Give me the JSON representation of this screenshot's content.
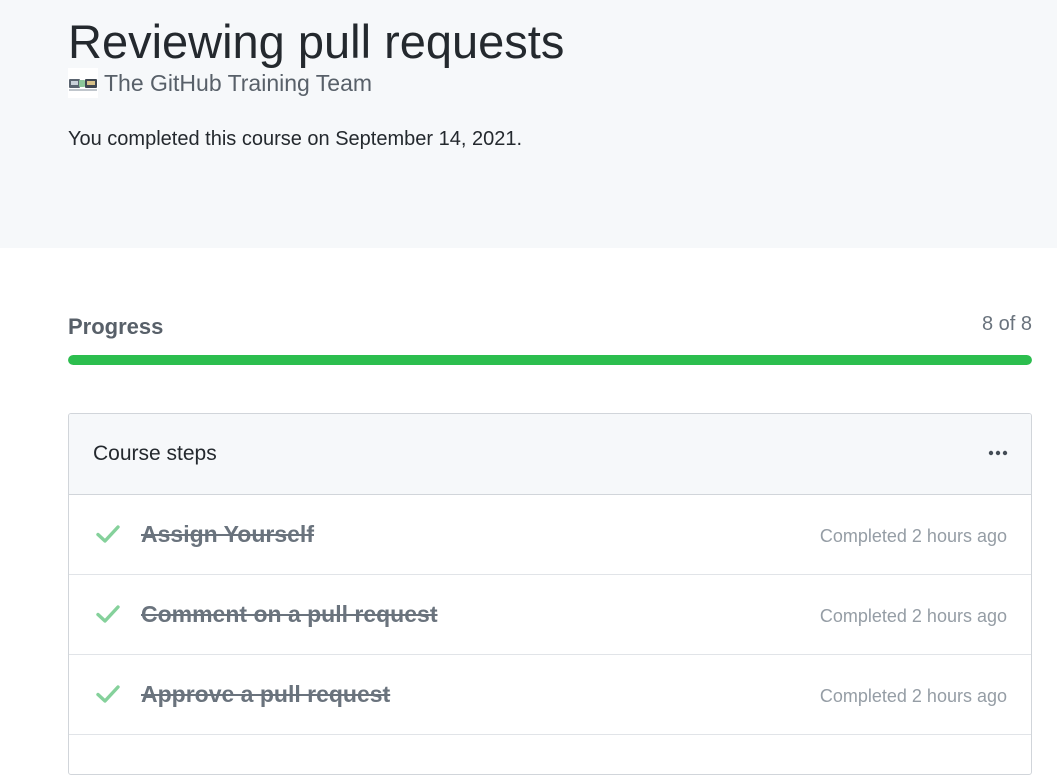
{
  "course": {
    "title": "Reviewing pull requests",
    "author": "The GitHub Training Team",
    "completion_text": "You completed this course on September 14, 2021."
  },
  "progress": {
    "label": "Progress",
    "count_text": "8 of 8",
    "completed": 8,
    "total": 8,
    "fraction": 1.0
  },
  "steps": {
    "title": "Course steps",
    "menu_icon": "kebab-horizontal-icon",
    "check_icon": "check-icon",
    "items": [
      {
        "title": "Assign Yourself",
        "status": "Completed 2 hours ago"
      },
      {
        "title": "Comment on a pull request",
        "status": "Completed 2 hours ago"
      },
      {
        "title": "Approve a pull request",
        "status": "Completed 2 hours ago"
      }
    ]
  },
  "colors": {
    "progress_fill": "#2cbe4e",
    "check": "#85d19b",
    "hero_background": "#f6f8fa"
  }
}
